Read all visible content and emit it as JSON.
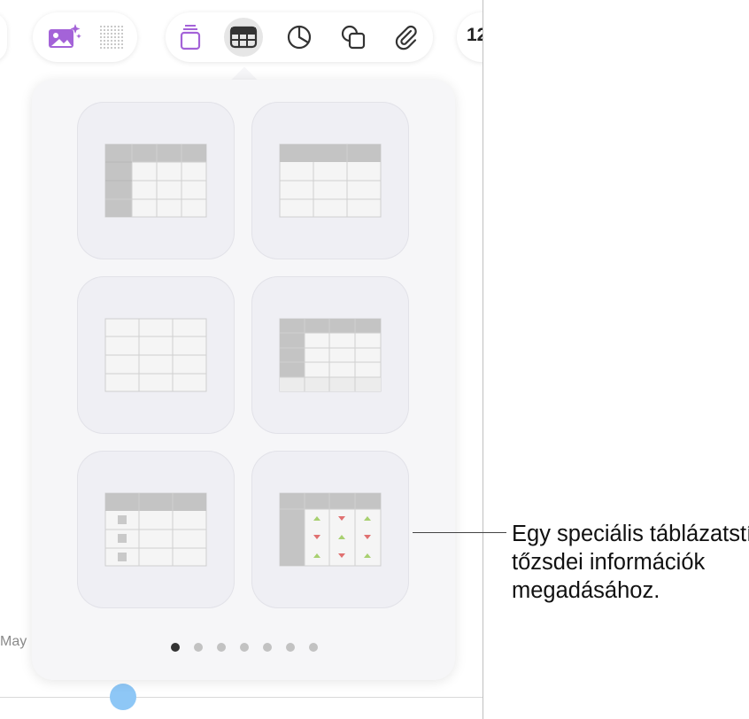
{
  "toolbar": {
    "page_number": "12",
    "media_icons": [
      "image-sparkle-icon",
      "grid-dots-icon"
    ],
    "insert_icons": [
      "text-box-icon",
      "table-icon",
      "chart-icon",
      "shape-icon",
      "paperclip-icon"
    ],
    "selected": "table-icon",
    "accent_color": "#9b59d0"
  },
  "background": {
    "axis_label": "May"
  },
  "table_styles": [
    {
      "name": "header-row-column-table"
    },
    {
      "name": "header-row-table"
    },
    {
      "name": "plain-table"
    },
    {
      "name": "header-footer-table"
    },
    {
      "name": "checklist-table"
    },
    {
      "name": "stock-table"
    }
  ],
  "pagination": {
    "count": 7,
    "active_index": 0
  },
  "callout": {
    "lines": [
      "Egy speciális táblázatstí",
      "tőzsdei információk",
      "megadásához."
    ]
  }
}
